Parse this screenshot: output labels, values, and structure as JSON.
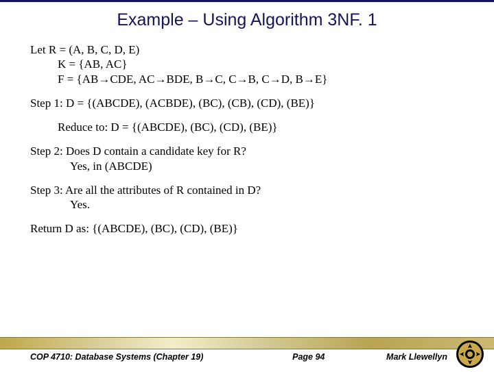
{
  "title": "Example – Using Algorithm 3NF. 1",
  "lines": {
    "l1": "Let R = (A, B, C, D, E)",
    "l2": "K = {AB, AC}",
    "l3a": "F = {AB",
    "l3b": "CDE, AC",
    "l3c": "BDE, B",
    "l3d": "C, C",
    "l3e": "B, C",
    "l3f": "D, B",
    "l3g": "E}",
    "step1": "Step 1: D = {(ABCDE), (ACBDE), (BC), (CB), (CD), (BE)}",
    "reduce": "Reduce to: D = {(ABCDE), (BC), (CD), (BE)}",
    "step2a": "Step 2: Does D contain a candidate key for R?",
    "step2b": "Yes, in (ABCDE)",
    "step3a": "Step 3: Are all the attributes of R contained in D?",
    "step3b": "Yes.",
    "ret": "Return D as: {(ABCDE), (BC), (CD), (BE)}"
  },
  "footer": {
    "course": "COP 4710: Database Systems  (Chapter 19)",
    "page": "Page 94",
    "author": "Mark Llewellyn"
  }
}
